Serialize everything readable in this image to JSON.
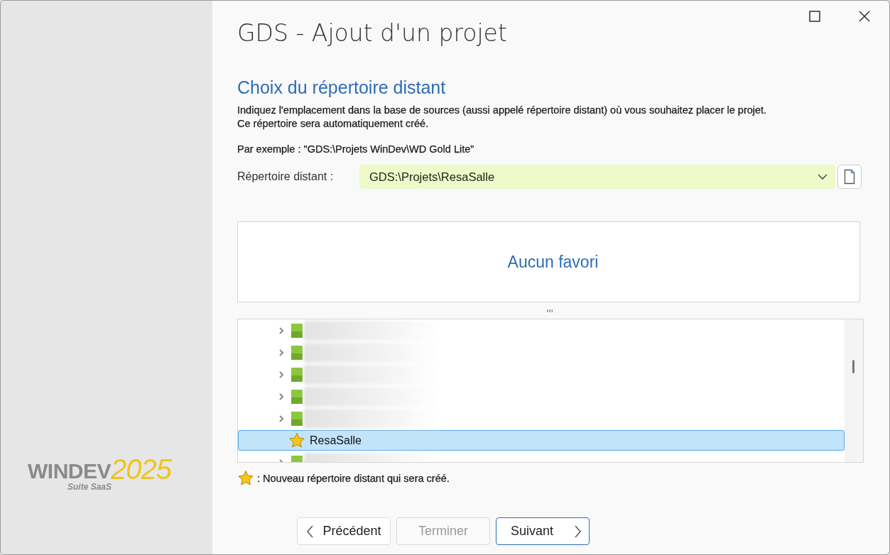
{
  "window": {
    "title": "GDS - Ajout d'un projet"
  },
  "logo": {
    "brand": "WINDEV",
    "version": "2025",
    "edition": "Suite SaaS"
  },
  "section": {
    "heading": "Choix du répertoire distant",
    "description": [
      "Indiquez l'emplacement dans la base de sources (aussi appelé répertoire distant) où vous souhaitez placer le projet.",
      "Ce répertoire sera automatiquement créé."
    ],
    "example": "Par exemple : \"GDS:\\Projets WinDev\\WD Gold Lite\""
  },
  "remote_dir": {
    "label": "Répertoire distant :",
    "value": "GDS:\\Projets\\ResaSalle"
  },
  "favorites": {
    "empty_text": "Aucun favori"
  },
  "tree": {
    "items": [
      {
        "kind": "folder",
        "expanded": false,
        "selected": false
      },
      {
        "kind": "folder",
        "expanded": false,
        "selected": false
      },
      {
        "kind": "folder",
        "expanded": false,
        "selected": false
      },
      {
        "kind": "folder",
        "expanded": false,
        "selected": false
      },
      {
        "kind": "folder",
        "expanded": false,
        "selected": false
      },
      {
        "kind": "new",
        "label": "ResaSalle",
        "selected": true
      },
      {
        "kind": "folder",
        "expanded": false,
        "selected": false
      }
    ]
  },
  "legend": ": Nouveau répertoire distant qui sera créé.",
  "buttons": [
    {
      "kind": "back",
      "label": "Précédent",
      "disabled": false,
      "default": false
    },
    {
      "kind": "finish",
      "label": "Terminer",
      "disabled": true,
      "default": false
    },
    {
      "kind": "next",
      "label": "Suivant",
      "disabled": false,
      "default": true
    }
  ]
}
